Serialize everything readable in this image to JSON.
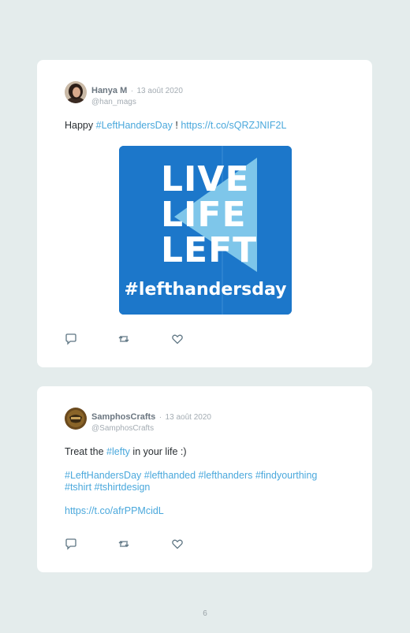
{
  "tweets": [
    {
      "author_name": "Hanya M",
      "date_sep": "·",
      "date": "13 août 2020",
      "handle": "@han_mags",
      "text_before": "Happy",
      "hashtag": "#LeftHandersDay",
      "text_after": "!",
      "url": "https://t.co/sQRZJNIF2L",
      "media": {
        "line1": "LIVE",
        "line2": "LIFE",
        "line3": "LEFT",
        "hashtag": "#lefthandersday",
        "bg_color": "#1a72c4"
      },
      "actions": [
        "reply-icon",
        "retweet-icon",
        "like-icon"
      ]
    },
    {
      "author_name": "SamphosCrafts",
      "date_sep": "·",
      "date": "13 août 2020",
      "handle": "@SamphosCrafts",
      "text_before": "Treat the",
      "hashtag": "#lefty",
      "text_after": "in your life :)",
      "hashtags_line1": "#LeftHandersDay #lefthanded #lefthanders #findyourthing",
      "hashtags_line2": "#tshirt #tshirtdesign",
      "url": "https://t.co/afrPPMcidL",
      "actions": [
        "reply-icon",
        "retweet-icon",
        "like-icon"
      ]
    }
  ],
  "page_number": "6",
  "colors": {
    "background": "#e4ecec",
    "card": "#ffffff",
    "link": "#4aa8dc",
    "icon": "#5f7684"
  }
}
